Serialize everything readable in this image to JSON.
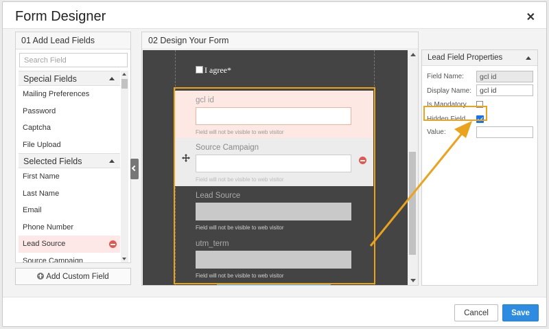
{
  "dialog": {
    "title": "Form Designer",
    "close_icon": "close-icon"
  },
  "left_panel": {
    "header": "01 Add Lead Fields",
    "search_placeholder": "Search Field",
    "special_fields": {
      "label": "Special Fields",
      "items": [
        "Mailing Preferences",
        "Password",
        "Captcha",
        "File Upload"
      ]
    },
    "selected_fields": {
      "label": "Selected Fields",
      "items": [
        "First Name",
        "Last Name",
        "Email",
        "Phone Number",
        "Lead Source",
        "Source Campaign"
      ],
      "active_item": "Lead Source"
    },
    "add_custom_label": "Add Custom Field"
  },
  "center_panel": {
    "header": "02 Design Your Form",
    "agree_label": "I agree*",
    "fields": [
      {
        "label": "gcl id",
        "note": "Field will not be visible to web visitor"
      },
      {
        "label": "Source Campaign",
        "note": "Field will not be visible to web visitor"
      },
      {
        "label": "Lead Source",
        "note": "Field will not be visible to web visitor"
      },
      {
        "label": "utm_term",
        "note": "Field will not be visible to web visitor"
      }
    ]
  },
  "right_panel": {
    "header": "Lead Field Properties",
    "field_name_label": "Field Name:",
    "field_name_value": "gcl id",
    "display_name_label": "Display Name:",
    "display_name_value": "gcl id",
    "is_mandatory_label": "Is Mandatory",
    "is_mandatory_checked": false,
    "hidden_field_label": "Hidden Field",
    "hidden_field_checked": true,
    "value_label": "Value:",
    "value_value": ""
  },
  "footer": {
    "cancel_label": "Cancel",
    "save_label": "Save"
  },
  "colors": {
    "highlight": "#e9a31c",
    "primary": "#2d8be2",
    "remove": "#e3574f",
    "canvas_bg": "#444444"
  }
}
